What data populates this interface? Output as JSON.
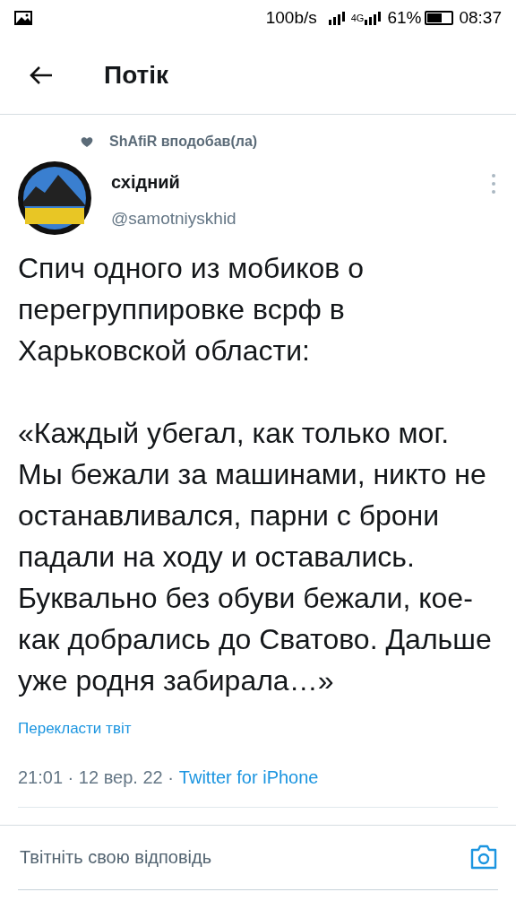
{
  "status_bar": {
    "speed": "100b/s",
    "network": "4G",
    "battery": {
      "percent": "61%",
      "level": 0.61
    },
    "time": "08:37"
  },
  "header": {
    "title": "Потік"
  },
  "social_context": "ShAfiR вподобав(ла)",
  "tweet": {
    "name": "східний",
    "handle": "@samotniyskhid",
    "paragraphs": [
      "Спич одного из мобиков о перегруппировке всрф в Харьковской области:",
      "«Каждый убегал, как только мог. Мы бежали за машинами, никто не останавливался, парни с брони падали на ходу и оставались. Буквально без обуви бежали, кое-как добрались до Сватово. Дальше уже родня забирала…»"
    ],
    "translate": "Перекласти твіт",
    "time": "21:01 · 12 вер. 22 ·",
    "source": "Twitter for iPhone"
  },
  "reply": {
    "placeholder": "Твітніть свою відповідь"
  }
}
